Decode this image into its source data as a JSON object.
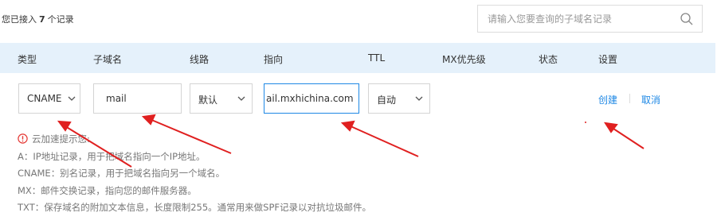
{
  "header": {
    "count_prefix": "您已接入",
    "count_value": "7",
    "count_suffix": "个记录",
    "search_placeholder": "请输入您要查询的子域名记录"
  },
  "columns": [
    "类型",
    "子域名",
    "线路",
    "指向",
    "TTL",
    "MX优先级",
    "状态",
    "设置"
  ],
  "form": {
    "type_value": "CNAME",
    "subdomain_value": "mail",
    "line_value": "默认",
    "target_value": "ail.mxhichina.com",
    "ttl_value": "自动",
    "create_label": "创建",
    "cancel_label": "取消"
  },
  "tips": {
    "title": "云加速提示您:",
    "lines": [
      "A：IP地址记录，用于把域名指向一个IP地址。",
      "CNAME：别名记录，用于把域名指向另一个域名。",
      "MX：邮件交换记录，指向您的邮件服务器。",
      "TXT：保存域名的附加文本信息，长度限制255。通常用来做SPF记录以对抗垃圾邮件。"
    ]
  },
  "colors": {
    "header_bg": "#e5f1fb",
    "link": "#1e88e5",
    "warn": "#e53935",
    "annotation_arrow": "#e02020"
  },
  "icons": {
    "search": "search-icon",
    "dropdown": "chevron-down-icon",
    "warning": "exclamation-circle-icon"
  }
}
